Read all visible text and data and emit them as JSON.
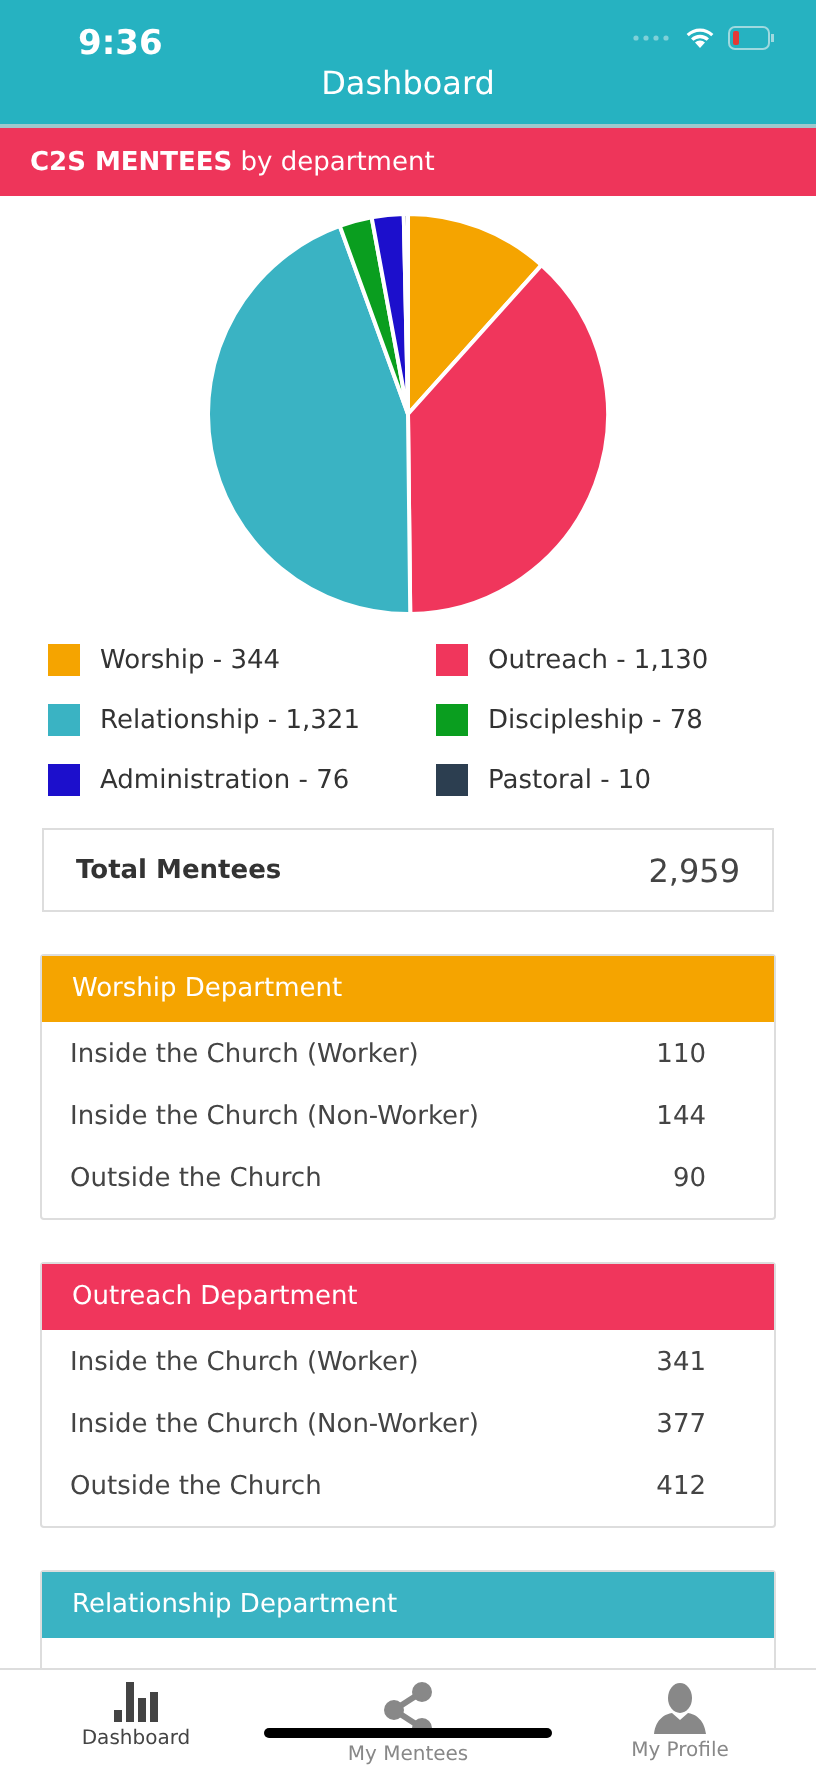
{
  "status_bar": {
    "time": "9:36"
  },
  "nav": {
    "title": "Dashboard"
  },
  "section_header": {
    "text": "**C2S MENTEES** by department"
  },
  "pie": {
    "chart_data": {
      "type": "pie",
      "categories": [
        "Worship - 344",
        "Outreach - 1,130",
        "Relationship - 1,321",
        "Discipleship - 78",
        "Administration - 76",
        "Pastoral - 10"
      ],
      "values": [
        11.63,
        38.19,
        44.64,
        2.63,
        2.57,
        0.34
      ],
      "colors": [
        "#f5a400",
        "#f0365c",
        "#3ab3c3",
        "#0a9e1f",
        "#1c0fcc",
        "#2c3e50"
      ]
    }
  },
  "total": {
    "label": "Total Mentees",
    "value": "2,959"
  },
  "departments": [
    {
      "title": "Worship Department",
      "color": "#f5a400",
      "rows": [
        {
          "label": "Inside the Church (Worker)",
          "value": "110"
        },
        {
          "label": "Inside the Church (Non-Worker)",
          "value": "144"
        },
        {
          "label": "Outside the Church",
          "value": "90"
        }
      ]
    },
    {
      "title": "Outreach Department",
      "color": "#f0365c",
      "rows": [
        {
          "label": "Inside the Church (Worker)",
          "value": "341"
        },
        {
          "label": "Inside the Church (Non-Worker)",
          "value": "377"
        },
        {
          "label": "Outside the Church",
          "value": "412"
        }
      ]
    },
    {
      "title": "Relationship Department",
      "color": "#3ab3c3"
    }
  ],
  "tab_bar": [
    {
      "label": "Dashboard",
      "selected": true
    },
    {
      "label": "My Mentees",
      "selected": false
    },
    {
      "label": "My Profile",
      "selected": false
    }
  ]
}
